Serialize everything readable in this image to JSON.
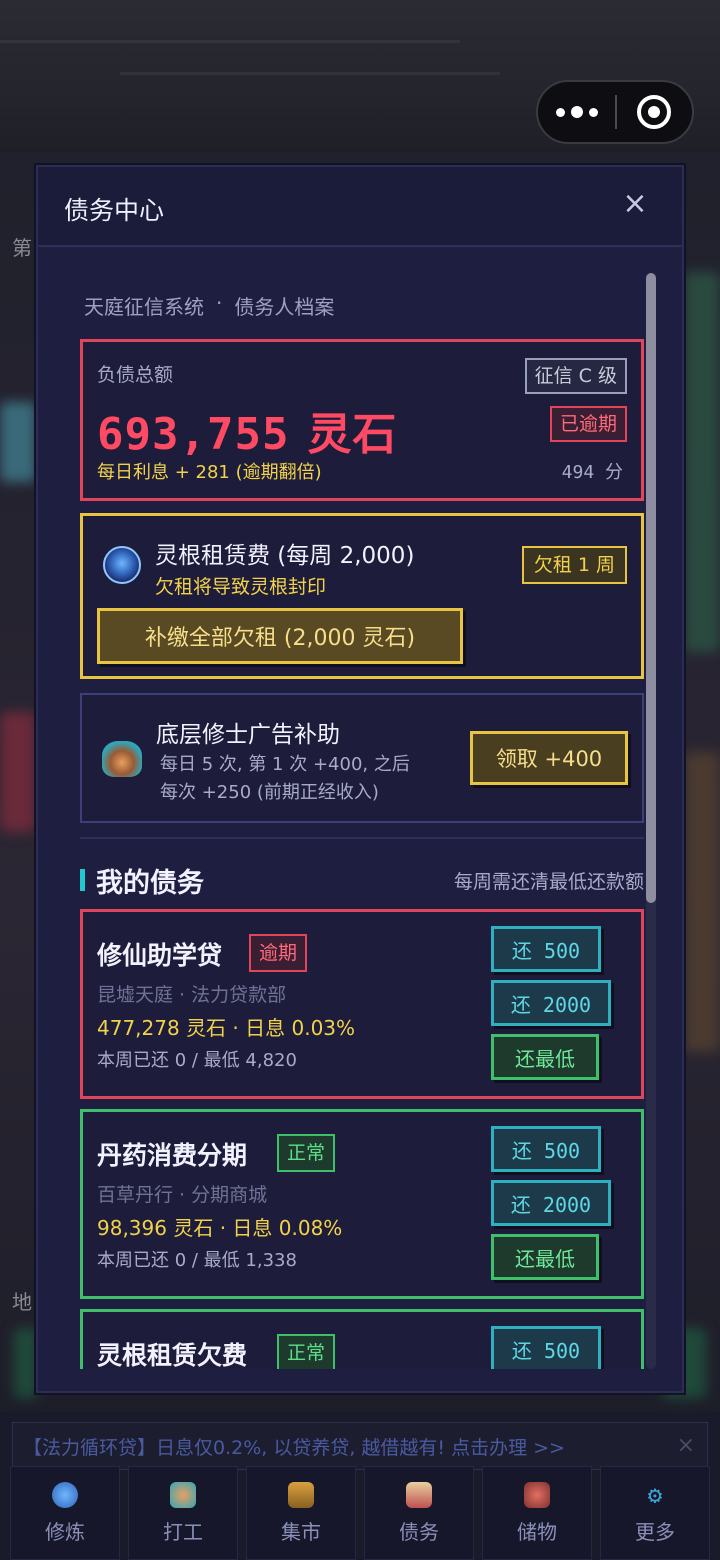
{
  "capsule": {
    "more_icon": "more-dots-icon",
    "close_icon": "target-circle-icon"
  },
  "background": {
    "side_char": "第",
    "map_label": "地"
  },
  "modal": {
    "title": "债务中心",
    "close_label": "×",
    "subtitle": {
      "system": "天庭征信系统",
      "sep": "·",
      "profile": "债务人档案"
    },
    "summary": {
      "label": "负债总额",
      "amount": "693,755",
      "unit": "灵石",
      "interest": "每日利息 + 281 (逾期翻倍)",
      "credit_badge": "征信 C 级",
      "overdue_badge": "已逾期",
      "score": "494 分",
      "accent": "#ff4a64"
    },
    "rent": {
      "title": "灵根租赁费 (每周 2,000)",
      "note": "欠租将导致灵根封印",
      "badge": "欠租 1 周",
      "button": "补缴全部欠租 (2,000 灵石)",
      "icon": "spirit-root-icon"
    },
    "ad": {
      "title": "底层修士广告补助",
      "desc_line1": "每日 5 次, 第 1 次 +400, 之后",
      "desc_line2": "每次 +250 (前期正经收入)",
      "button": "领取 +400",
      "icon": "cultivator-avatar-icon"
    },
    "section": {
      "title": "我的债务",
      "hint": "每周需还清最低还款额"
    },
    "debts": [
      {
        "name": "修仙助学贷",
        "status": "逾期",
        "lender": "昆墟天庭 · 法力贷款部",
        "balance": "477,278 灵石 · 日息 0.03%",
        "progress": "本周已还 0 / 最低 4,820",
        "btn1": "还 500",
        "btn2": "还 2000",
        "btn3": "还最低"
      },
      {
        "name": "丹药消费分期",
        "status": "正常",
        "lender": "百草丹行 · 分期商城",
        "balance": "98,396 灵石 · 日息 0.08%",
        "progress": "本周已还 0 / 最低 1,338",
        "btn1": "还 500",
        "btn2": "还 2000",
        "btn3": "还最低"
      },
      {
        "name": "灵根租赁欠费",
        "status": "正常",
        "btn1": "还 500"
      }
    ]
  },
  "ticker": {
    "text": "【法力循环贷】日息仅0.2%, 以贷养贷, 越借越有! 点击办理 >>",
    "close": "×"
  },
  "nav": [
    {
      "label": "修炼",
      "icon": "cultivate-icon",
      "color": "#4a8fd8"
    },
    {
      "label": "打工",
      "icon": "work-icon",
      "color": "#3ab0a0"
    },
    {
      "label": "集市",
      "icon": "scale-icon",
      "color": "#d8a040"
    },
    {
      "label": "债务",
      "icon": "scroll-icon",
      "color": "#c05050"
    },
    {
      "label": "储物",
      "icon": "bag-icon",
      "color": "#c04848"
    },
    {
      "label": "更多",
      "icon": "gear-icon",
      "color": "#3aa3d8"
    }
  ]
}
